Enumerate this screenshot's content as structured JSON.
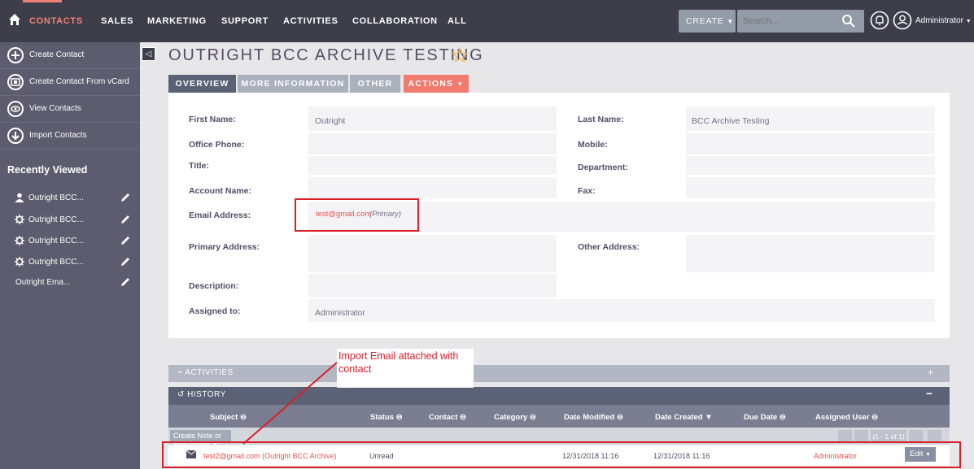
{
  "nav": {
    "items": [
      "CONTACTS",
      "SALES",
      "MARKETING",
      "SUPPORT",
      "ACTIVITIES",
      "COLLABORATION",
      "ALL"
    ],
    "create_label": "CREATE",
    "search_placeholder": "Search...",
    "user_label": "Administrator",
    "accent_color": "#f08377"
  },
  "sidebar": {
    "actions": [
      "Create Contact",
      "Create Contact From vCard",
      "View Contacts",
      "Import Contacts"
    ],
    "recent_title": "Recently Viewed",
    "recent_items": [
      {
        "label": "Outright BCC...",
        "icon": "person-icon"
      },
      {
        "label": "Outright BCC...",
        "icon": "gear-icon"
      },
      {
        "label": "Outright BCC...",
        "icon": "gear-icon"
      },
      {
        "label": "Outright BCC...",
        "icon": "gear-icon"
      },
      {
        "label": "Outright Ema...",
        "icon": ""
      }
    ]
  },
  "page": {
    "title": "OUTRIGHT BCC ARCHIVE TESTING",
    "tabs": [
      "OVERVIEW",
      "MORE INFORMATION",
      "OTHER",
      "ACTIONS"
    ]
  },
  "fields": {
    "first_name_label": "First Name:",
    "first_name_value": "Outright",
    "last_name_label": "Last Name:",
    "last_name_value": "BCC Archive Testing",
    "office_phone_label": "Office Phone:",
    "mobile_label": "Mobile:",
    "title_label": "Title:",
    "department_label": "Department:",
    "account_name_label": "Account Name:",
    "fax_label": "Fax:",
    "email_label": "Email Address:",
    "email_value": "test@gmail.com",
    "email_primary": "(Primary)",
    "primary_address_label": "Primary Address:",
    "other_address_label": "Other Address:",
    "description_label": "Description:",
    "assigned_to_label": "Assigned to:",
    "assigned_to_value": "Administrator"
  },
  "annotation": {
    "text": "Import Email attached with contact"
  },
  "subpanels": {
    "activities": "ACTIVITIES",
    "history": "HISTORY",
    "columns": [
      "Subject",
      "Status",
      "Contact",
      "Category",
      "Date Modified",
      "Date Created",
      "Due Date",
      "Assigned User"
    ],
    "create_note": "Create Note or Attachment",
    "pager": "(1 - 1 of 1)",
    "row": {
      "subject": "test2@gmail.com (Outright BCC Archive)",
      "status": "Unread",
      "date_modified": "12/31/2018 11:16",
      "date_created": "12/31/2018 11:16",
      "assigned_user": "Administrator",
      "edit": "Edit"
    }
  }
}
